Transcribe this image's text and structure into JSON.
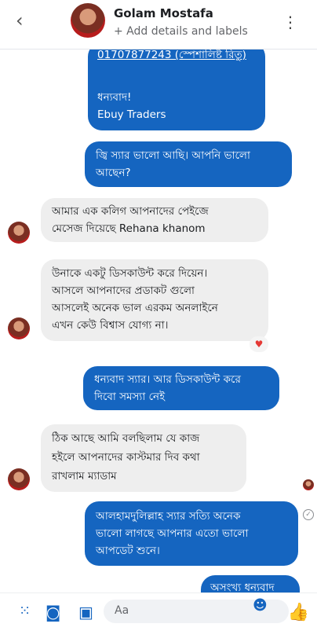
{
  "header": {
    "back_icon": "chevron-left-icon",
    "name": "Golam Mostafa",
    "subtitle": "+ Add details and labels",
    "more_icon": "vertical-dots-icon"
  },
  "messages": {
    "m1": {
      "line1": "01707877243 (স্পেশালিষ্ট রিতু)",
      "line3": "ধন্যবাদ!",
      "line4": "Ebuy Traders"
    },
    "m2": {
      "line1": "জ্বি স্যার ভালো আছি। আপনি ভালো",
      "line2": "আছেন?"
    },
    "m3": {
      "line1": "আমার এক কলিগ আপনাদের পেইজে",
      "line2": "মেসেজ দিয়েছে Rehana khanom"
    },
    "m4": {
      "line1": "উনাকে একটু ডিসকাউন্ট করে দিয়েন।",
      "line2": "আসলে আপনাদের প্রডাকট গুলো",
      "line3": "আসলেই অনেক ভাল এরকম অনলাইনে",
      "line4": "এখন কেউ বিশ্বাস যোগ্য না।"
    },
    "reaction": "♥",
    "m5": {
      "line1": "ধন্যবাদ স্যার। আর ডিসকাউন্ট করে",
      "line2": "দিবো সমস্যা নেই"
    },
    "m6": {
      "line1": "ঠিক আছে আমি বলছিলাম যে কাজ",
      "line2": "হইলে আপনাদের কাস্টমার দিব কথা",
      "line3": "রাখলাম ম্যাডাম"
    },
    "m7": {
      "line1": "আলহামদুলিল্লাহ স্যার সত্যি অনেক",
      "line2": "ভালো লাগছে আপনার এতো ভালো",
      "line3": "আপডেট শুনে।"
    },
    "m8": {
      "line1": "অসংখ্য ধন্যবাদ"
    }
  },
  "composer": {
    "placeholder": "Aa"
  },
  "colors": {
    "outgoing": "#1565c0",
    "incoming": "#eeeeee"
  }
}
